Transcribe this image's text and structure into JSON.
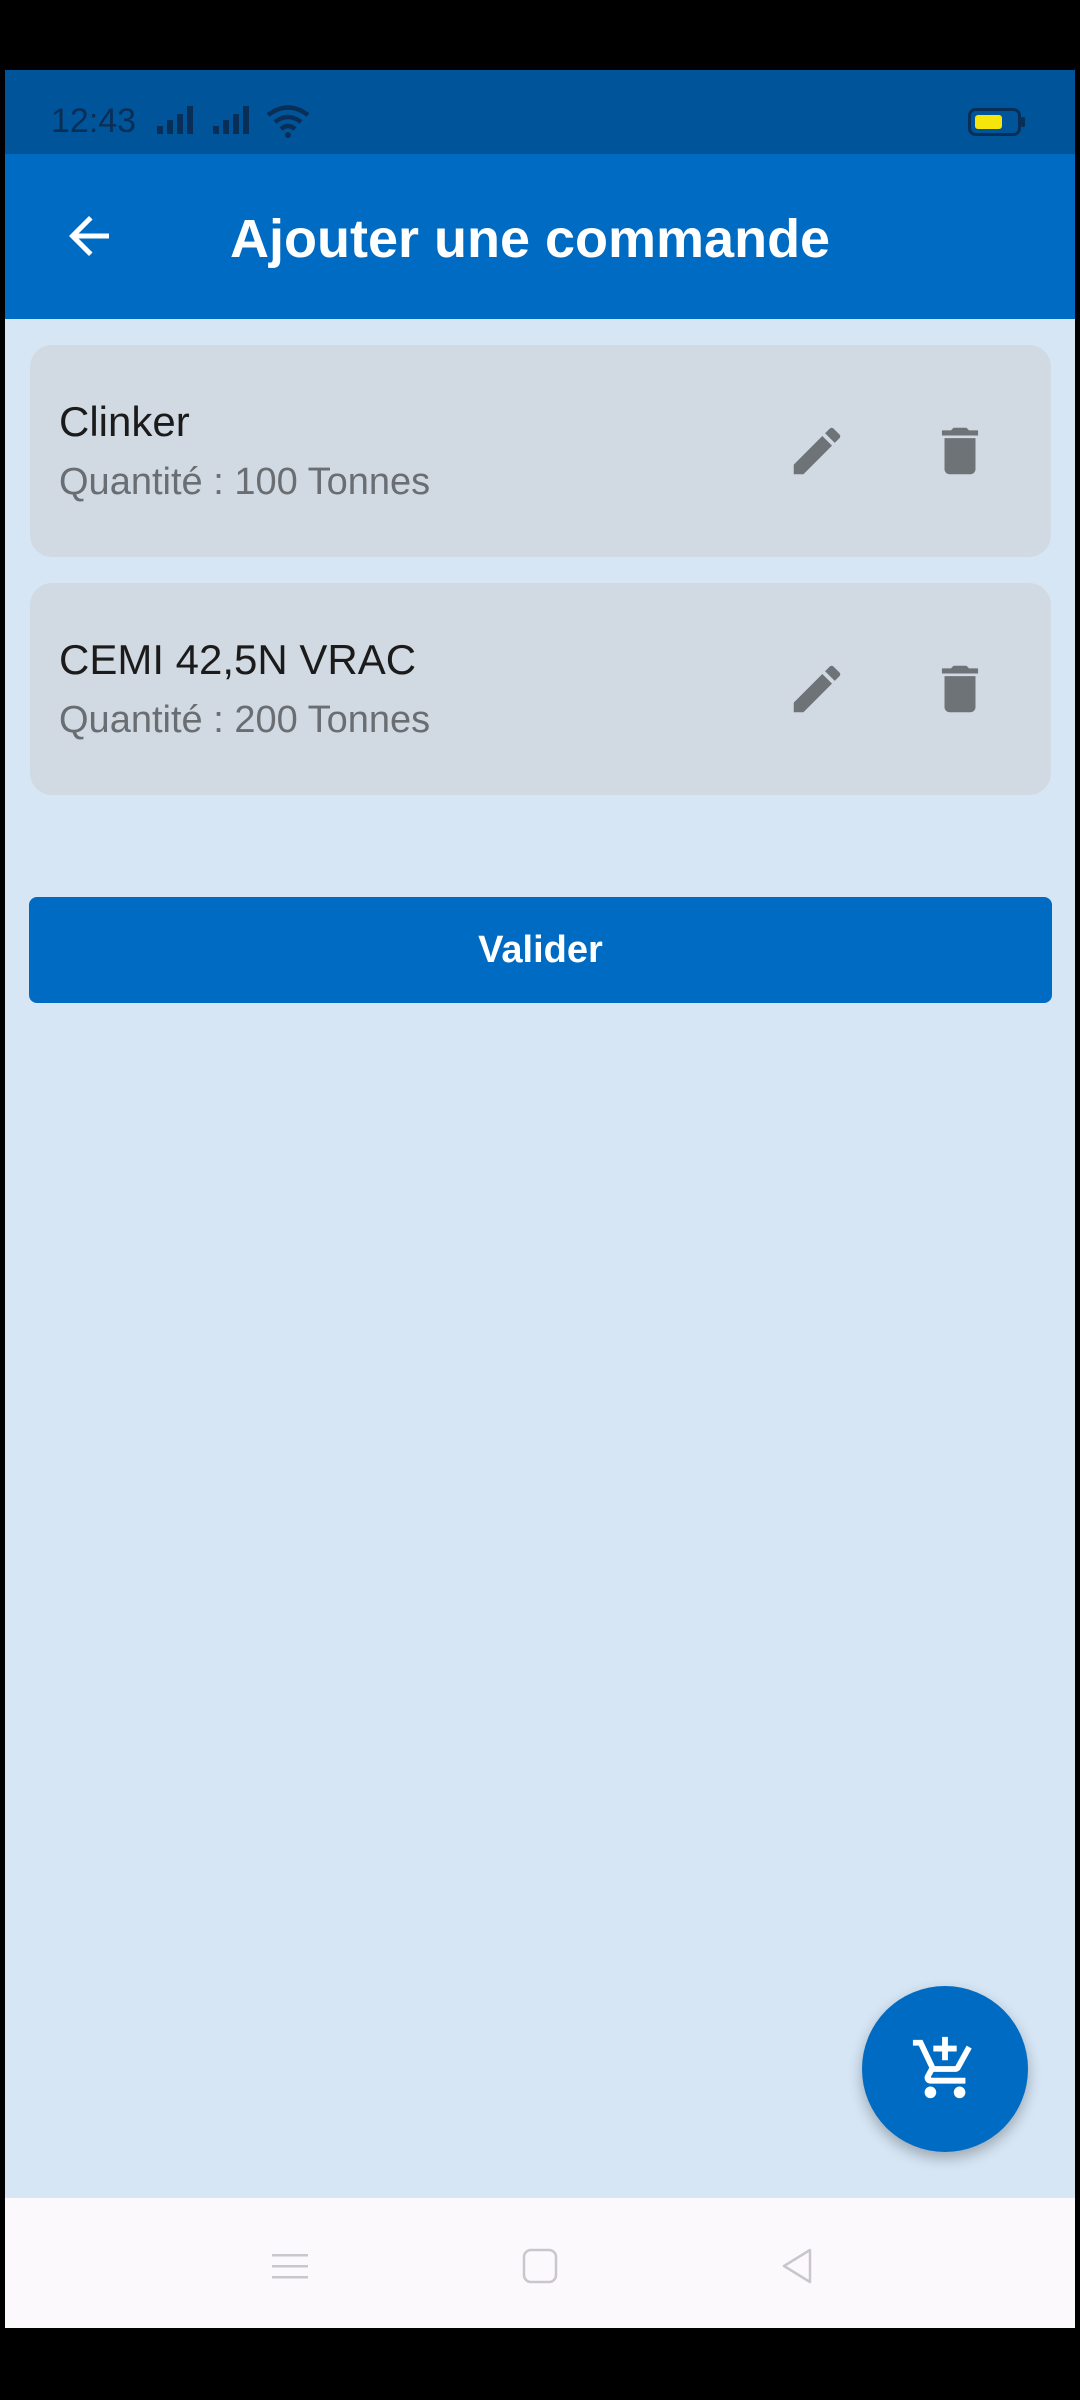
{
  "status_bar": {
    "time": "12:43",
    "icons": [
      "signal-icon",
      "signal-icon",
      "wifi-icon",
      "battery-icon"
    ],
    "battery_color": "#f5e50a"
  },
  "app_bar": {
    "title": "Ajouter une commande",
    "back_icon": "arrow-left-icon"
  },
  "orders": [
    {
      "product": "Clinker",
      "quantity": "Quantité : 100 Tonnes"
    },
    {
      "product": "CEMI 42,5N VRAC",
      "quantity": "Quantité : 200 Tonnes"
    }
  ],
  "actions": {
    "validate_label": "Valider",
    "fab_icon": "add-shopping-cart-icon"
  },
  "nav_bar": {
    "icons": [
      "menu-icon",
      "home-icon",
      "back-triangle-icon"
    ]
  },
  "colors": {
    "primary": "#006bc2",
    "status_bar": "#00549a",
    "background": "#d6e6f5",
    "card": "#d1dae2",
    "icon_gray": "#6e7377"
  }
}
